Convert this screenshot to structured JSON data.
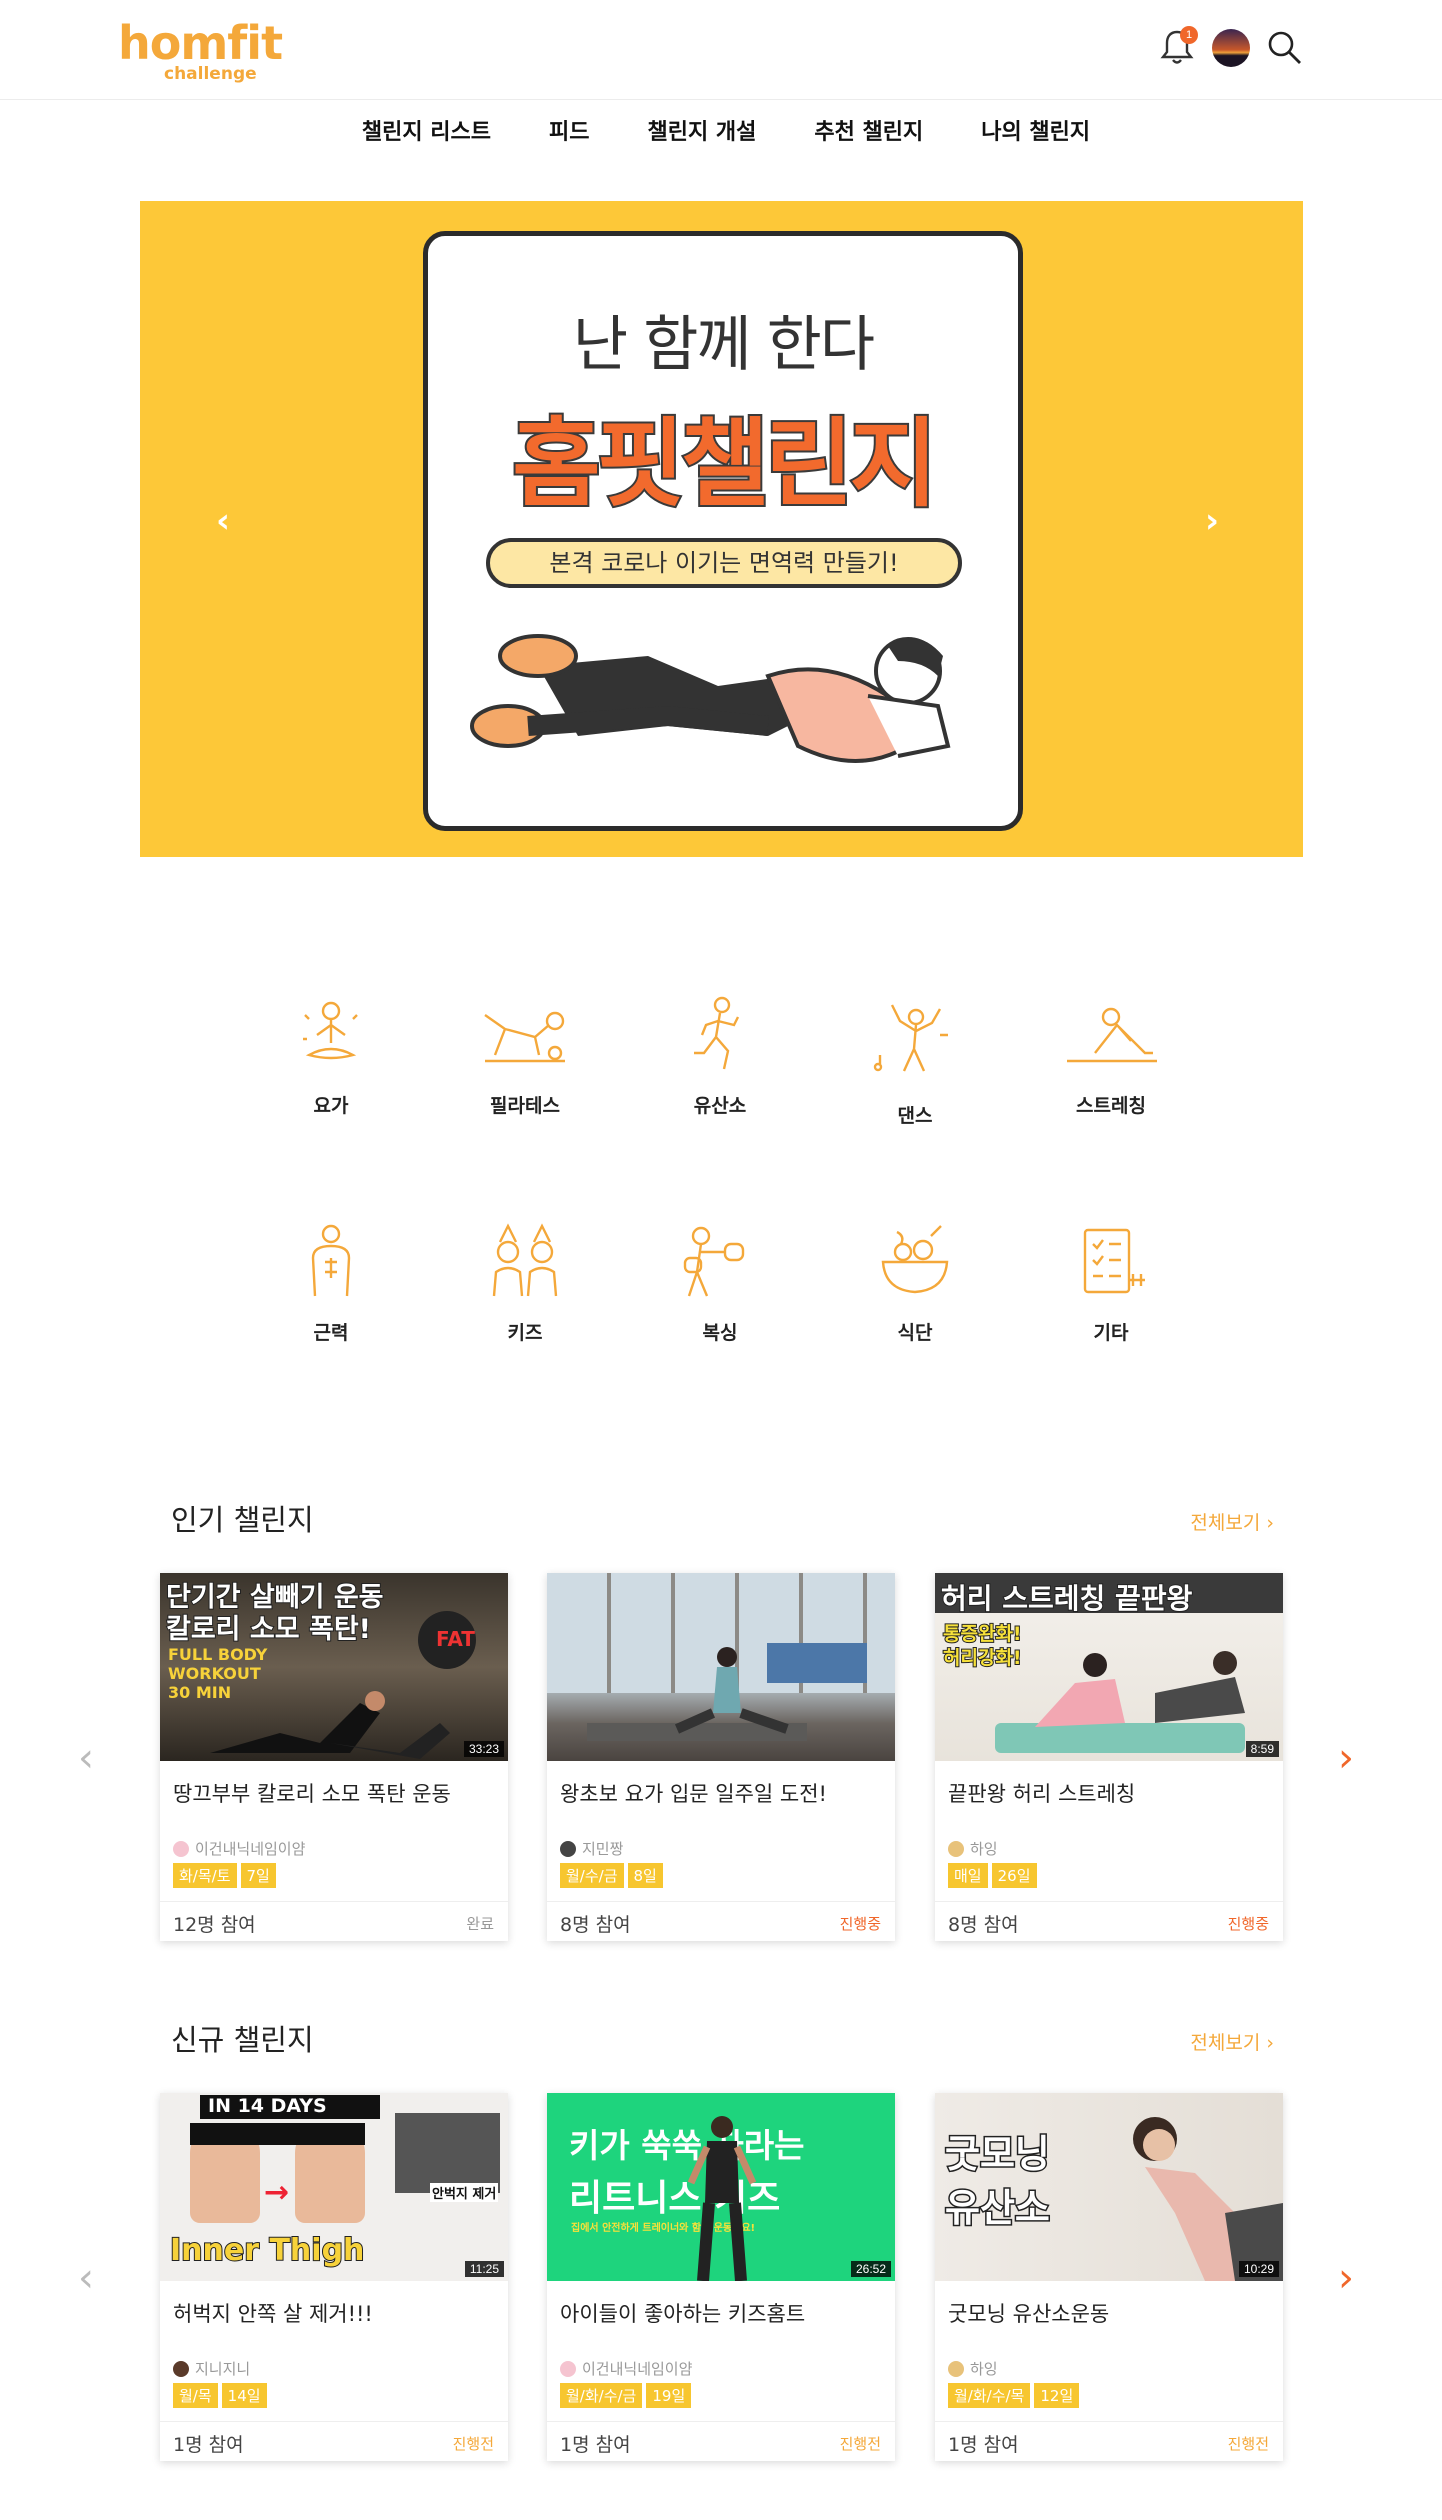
{
  "header": {
    "logo_main": "homfit",
    "logo_sub": "challenge",
    "notification_count": "1"
  },
  "nav": [
    "챌린지 리스트",
    "피드",
    "챌린지 개설",
    "추천 챌린지",
    "나의 챌린지"
  ],
  "banner": {
    "line1": "난 함께 한다",
    "line2": "홈핏챌린지",
    "pill": "본격 코로나 이기는 면역력 만들기!"
  },
  "categories": [
    "요가",
    "필라테스",
    "유산소",
    "댄스",
    "스트레칭",
    "근력",
    "키즈",
    "복싱",
    "식단",
    "기타"
  ],
  "popular": {
    "title": "인기 챌린지",
    "see_all": "전체보기",
    "cards": [
      {
        "title": "땅끄부부 칼로리 소모 폭탄 운동",
        "user": "이건내닉네임이얌",
        "tags": [
          "화/목/토",
          "7일"
        ],
        "participants": "12명 참여",
        "status": "완료",
        "duration": "33:23",
        "thumb_text": [
          "단기간 살빼기 운동",
          "칼로리 소모 폭탄!",
          "FULL BODY",
          "WORKOUT",
          "30 MIN",
          "FAT"
        ]
      },
      {
        "title": "왕초보 요가 입문 일주일 도전!",
        "user": "지민짱",
        "tags": [
          "월/수/금",
          "8일"
        ],
        "participants": "8명 참여",
        "status": "진행중",
        "duration": "",
        "thumb_text": []
      },
      {
        "title": "끝판왕 허리 스트레칭",
        "user": "하잉",
        "tags": [
          "매일",
          "26일"
        ],
        "participants": "8명 참여",
        "status": "진행중",
        "duration": "8:59",
        "thumb_text": [
          "허리 스트레칭 끝판왕",
          "통증완화!",
          "허리강화!"
        ]
      }
    ]
  },
  "new": {
    "title": "신규 챌린지",
    "see_all": "전체보기",
    "cards": [
      {
        "title": "허벅지 안쪽 살 제거!!!",
        "user": "지니지니",
        "tags": [
          "월/목",
          "14일"
        ],
        "participants": "1명 참여",
        "status": "진행전",
        "duration": "11:25",
        "thumb_text": [
          "IN 14 DAYS",
          "Inner Thigh",
          "안벅지 제거"
        ]
      },
      {
        "title": "아이들이 좋아하는 키즈홈트",
        "user": "이건내닉네임이얌",
        "tags": [
          "월/화/수/금",
          "19일"
        ],
        "participants": "1명 참여",
        "status": "진행전",
        "duration": "26:52",
        "thumb_text": [
          "키가 쑥쑥 자라는",
          "리트니스 키즈",
          "집에서 안전하게 트레이너와 함께 운동해요!"
        ]
      },
      {
        "title": "굿모닝 유산소운동",
        "user": "하잉",
        "tags": [
          "월/화/수/목",
          "12일"
        ],
        "participants": "1명 참여",
        "status": "진행전",
        "duration": "10:29",
        "thumb_text": [
          "굿모닝",
          "유산소"
        ]
      }
    ]
  },
  "colors": {
    "brand": "#f4a83a",
    "banner_bg": "#fdc838",
    "tag": "#f7c62f",
    "status_active": "#f0672b",
    "status_done": "#999999",
    "status_pending": "#f4a83a"
  }
}
